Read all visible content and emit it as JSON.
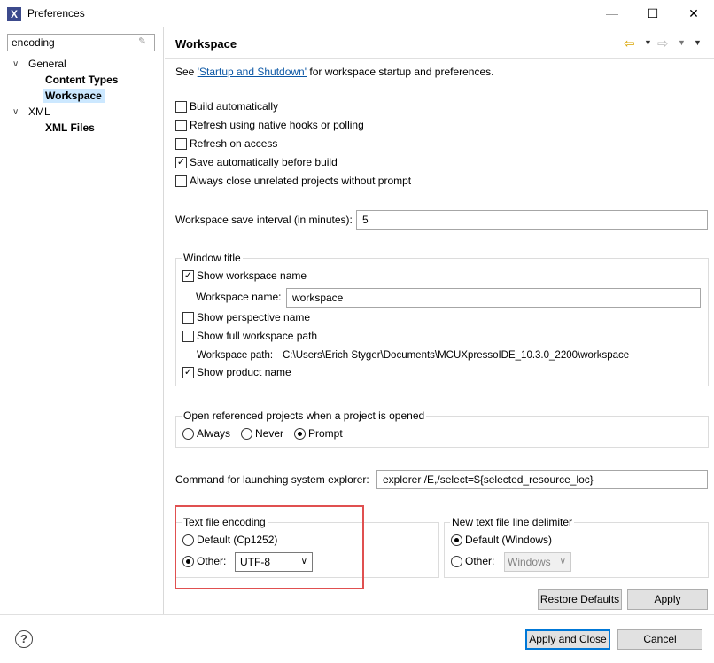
{
  "window": {
    "title": "Preferences",
    "app_icon": "eclipse-x-icon",
    "controls": {
      "minimize": "minimize-icon",
      "maximize": "maximize-icon",
      "close": "close-icon"
    }
  },
  "sidebar": {
    "filter_value": "encoding",
    "tree": [
      {
        "label": "General",
        "expanded": true,
        "children": [
          "Content Types",
          "Workspace"
        ]
      },
      {
        "label": "XML",
        "expanded": true,
        "children": [
          "XML Files"
        ]
      }
    ],
    "selected": "Workspace"
  },
  "page": {
    "title": "Workspace",
    "intro_prefix": "See ",
    "intro_link": "'Startup and Shutdown'",
    "intro_suffix": " for workspace startup and preferences.",
    "checkboxes": [
      {
        "label": "Build automatically",
        "checked": false
      },
      {
        "label": "Refresh using native hooks or polling",
        "checked": false
      },
      {
        "label": "Refresh on access",
        "checked": false
      },
      {
        "label": "Save automatically before build",
        "checked": true
      },
      {
        "label": "Always close unrelated projects without prompt",
        "checked": false
      }
    ],
    "save_interval_label": "Workspace save interval (in minutes):",
    "save_interval_value": "5",
    "window_title": {
      "group_label": "Window title",
      "show_workspace_name": "Show workspace name",
      "workspace_name_label": "Workspace name:",
      "workspace_name_value": "workspace",
      "show_perspective_name": "Show perspective name",
      "show_full_path": "Show full workspace path",
      "workspace_path_label": "Workspace path:",
      "workspace_path_value": "C:\\Users\\Erich Styger\\Documents\\MCUXpressoIDE_10.3.0_2200\\workspace",
      "show_product_name": "Show product name"
    },
    "open_referenced": {
      "group_label": "Open referenced projects when a project is opened",
      "options": [
        "Always",
        "Never",
        "Prompt"
      ],
      "selected": "Prompt"
    },
    "explorer_label": "Command for launching system explorer:",
    "explorer_value": "explorer /E,/select=${selected_resource_loc}",
    "encoding": {
      "group_label": "Text file encoding",
      "default_label": "Default (Cp1252)",
      "other_label": "Other:",
      "other_value": "UTF-8",
      "selected": "Other"
    },
    "line_delimiter": {
      "group_label": "New text file line delimiter",
      "default_label": "Default (Windows)",
      "other_label": "Other:",
      "other_value": "Windows",
      "selected": "Default"
    },
    "restore_defaults": "Restore Defaults",
    "apply": "Apply"
  },
  "footer": {
    "help_icon": "help-icon",
    "apply_close": "Apply and Close",
    "cancel": "Cancel"
  },
  "colors": {
    "selection": "#cce8ff",
    "highlight_box": "#e05050",
    "link": "#0b57a5",
    "default_button_border": "#0078d7"
  }
}
